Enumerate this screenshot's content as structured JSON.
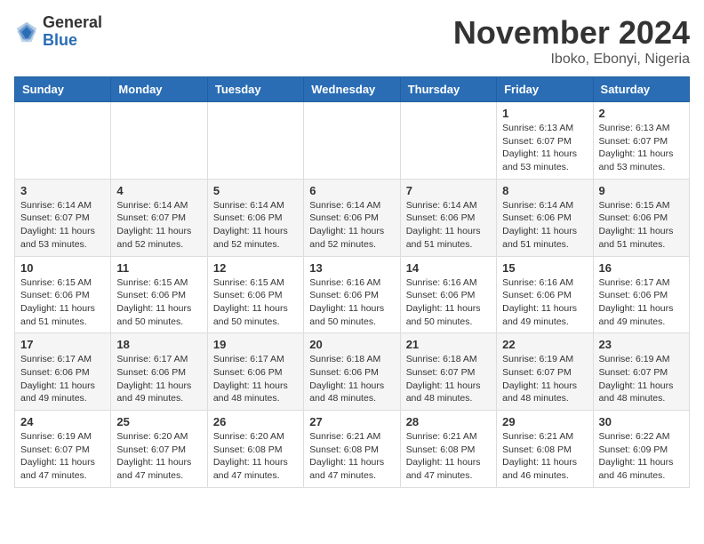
{
  "header": {
    "logo_general": "General",
    "logo_blue": "Blue",
    "title": "November 2024",
    "location": "Iboko, Ebonyi, Nigeria"
  },
  "weekdays": [
    "Sunday",
    "Monday",
    "Tuesday",
    "Wednesday",
    "Thursday",
    "Friday",
    "Saturday"
  ],
  "weeks": [
    [
      {
        "day": "",
        "info": ""
      },
      {
        "day": "",
        "info": ""
      },
      {
        "day": "",
        "info": ""
      },
      {
        "day": "",
        "info": ""
      },
      {
        "day": "",
        "info": ""
      },
      {
        "day": "1",
        "info": "Sunrise: 6:13 AM\nSunset: 6:07 PM\nDaylight: 11 hours\nand 53 minutes."
      },
      {
        "day": "2",
        "info": "Sunrise: 6:13 AM\nSunset: 6:07 PM\nDaylight: 11 hours\nand 53 minutes."
      }
    ],
    [
      {
        "day": "3",
        "info": "Sunrise: 6:14 AM\nSunset: 6:07 PM\nDaylight: 11 hours\nand 53 minutes."
      },
      {
        "day": "4",
        "info": "Sunrise: 6:14 AM\nSunset: 6:07 PM\nDaylight: 11 hours\nand 52 minutes."
      },
      {
        "day": "5",
        "info": "Sunrise: 6:14 AM\nSunset: 6:06 PM\nDaylight: 11 hours\nand 52 minutes."
      },
      {
        "day": "6",
        "info": "Sunrise: 6:14 AM\nSunset: 6:06 PM\nDaylight: 11 hours\nand 52 minutes."
      },
      {
        "day": "7",
        "info": "Sunrise: 6:14 AM\nSunset: 6:06 PM\nDaylight: 11 hours\nand 51 minutes."
      },
      {
        "day": "8",
        "info": "Sunrise: 6:14 AM\nSunset: 6:06 PM\nDaylight: 11 hours\nand 51 minutes."
      },
      {
        "day": "9",
        "info": "Sunrise: 6:15 AM\nSunset: 6:06 PM\nDaylight: 11 hours\nand 51 minutes."
      }
    ],
    [
      {
        "day": "10",
        "info": "Sunrise: 6:15 AM\nSunset: 6:06 PM\nDaylight: 11 hours\nand 51 minutes."
      },
      {
        "day": "11",
        "info": "Sunrise: 6:15 AM\nSunset: 6:06 PM\nDaylight: 11 hours\nand 50 minutes."
      },
      {
        "day": "12",
        "info": "Sunrise: 6:15 AM\nSunset: 6:06 PM\nDaylight: 11 hours\nand 50 minutes."
      },
      {
        "day": "13",
        "info": "Sunrise: 6:16 AM\nSunset: 6:06 PM\nDaylight: 11 hours\nand 50 minutes."
      },
      {
        "day": "14",
        "info": "Sunrise: 6:16 AM\nSunset: 6:06 PM\nDaylight: 11 hours\nand 50 minutes."
      },
      {
        "day": "15",
        "info": "Sunrise: 6:16 AM\nSunset: 6:06 PM\nDaylight: 11 hours\nand 49 minutes."
      },
      {
        "day": "16",
        "info": "Sunrise: 6:17 AM\nSunset: 6:06 PM\nDaylight: 11 hours\nand 49 minutes."
      }
    ],
    [
      {
        "day": "17",
        "info": "Sunrise: 6:17 AM\nSunset: 6:06 PM\nDaylight: 11 hours\nand 49 minutes."
      },
      {
        "day": "18",
        "info": "Sunrise: 6:17 AM\nSunset: 6:06 PM\nDaylight: 11 hours\nand 49 minutes."
      },
      {
        "day": "19",
        "info": "Sunrise: 6:17 AM\nSunset: 6:06 PM\nDaylight: 11 hours\nand 48 minutes."
      },
      {
        "day": "20",
        "info": "Sunrise: 6:18 AM\nSunset: 6:06 PM\nDaylight: 11 hours\nand 48 minutes."
      },
      {
        "day": "21",
        "info": "Sunrise: 6:18 AM\nSunset: 6:07 PM\nDaylight: 11 hours\nand 48 minutes."
      },
      {
        "day": "22",
        "info": "Sunrise: 6:19 AM\nSunset: 6:07 PM\nDaylight: 11 hours\nand 48 minutes."
      },
      {
        "day": "23",
        "info": "Sunrise: 6:19 AM\nSunset: 6:07 PM\nDaylight: 11 hours\nand 48 minutes."
      }
    ],
    [
      {
        "day": "24",
        "info": "Sunrise: 6:19 AM\nSunset: 6:07 PM\nDaylight: 11 hours\nand 47 minutes."
      },
      {
        "day": "25",
        "info": "Sunrise: 6:20 AM\nSunset: 6:07 PM\nDaylight: 11 hours\nand 47 minutes."
      },
      {
        "day": "26",
        "info": "Sunrise: 6:20 AM\nSunset: 6:08 PM\nDaylight: 11 hours\nand 47 minutes."
      },
      {
        "day": "27",
        "info": "Sunrise: 6:21 AM\nSunset: 6:08 PM\nDaylight: 11 hours\nand 47 minutes."
      },
      {
        "day": "28",
        "info": "Sunrise: 6:21 AM\nSunset: 6:08 PM\nDaylight: 11 hours\nand 47 minutes."
      },
      {
        "day": "29",
        "info": "Sunrise: 6:21 AM\nSunset: 6:08 PM\nDaylight: 11 hours\nand 46 minutes."
      },
      {
        "day": "30",
        "info": "Sunrise: 6:22 AM\nSunset: 6:09 PM\nDaylight: 11 hours\nand 46 minutes."
      }
    ]
  ]
}
